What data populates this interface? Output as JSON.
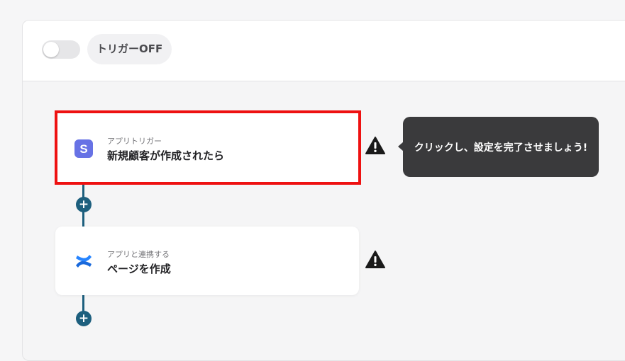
{
  "header": {
    "toggle_state": "off",
    "trigger_status_label": "トリガーOFF"
  },
  "steps": [
    {
      "kind": "アプリトリガー",
      "title": "新規顧客が作成されたら",
      "app_icon": "stripe-icon",
      "icon_color": "#6772e5",
      "icon_letter": "S",
      "highlighted": true,
      "warning_icon": "warning-icon"
    },
    {
      "kind": "アプリと連携する",
      "title": "ページを作成",
      "app_icon": "confluence-icon",
      "icon_color": "#1868db",
      "highlighted": false,
      "warning_icon": "warning-icon"
    }
  ],
  "tooltip": {
    "text": "クリックし、設定を完了させましょう!"
  },
  "add_step": {
    "icon": "plus-icon",
    "glyph": "+"
  },
  "colors": {
    "connector": "#1d5f7e",
    "highlight_border": "#ee1111",
    "tooltip_bg": "#3a3a3c"
  }
}
